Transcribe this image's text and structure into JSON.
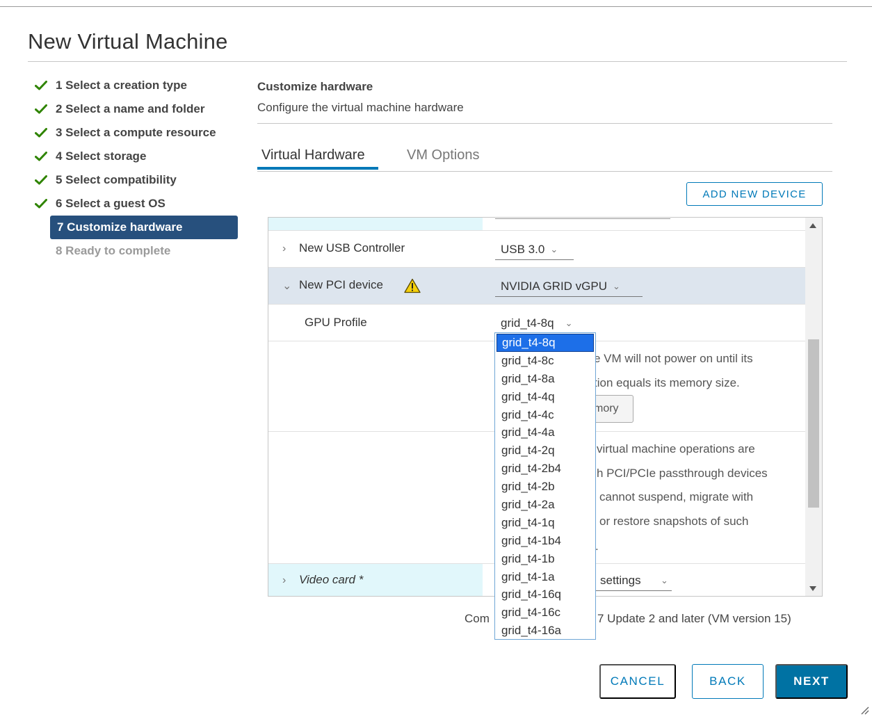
{
  "dialog": {
    "title": "New Virtual Machine"
  },
  "steps": [
    {
      "label": "1 Select a creation type",
      "status": "complete"
    },
    {
      "label": "2 Select a name and folder",
      "status": "complete"
    },
    {
      "label": "3 Select a compute resource",
      "status": "complete"
    },
    {
      "label": "4 Select storage",
      "status": "complete"
    },
    {
      "label": "5 Select compatibility",
      "status": "complete"
    },
    {
      "label": "6 Select a guest OS",
      "status": "complete"
    },
    {
      "label": "7 Customize hardware",
      "status": "active"
    },
    {
      "label": "8 Ready to complete",
      "status": "disabled"
    }
  ],
  "section": {
    "title": "Customize hardware",
    "subtitle": "Configure the virtual machine hardware"
  },
  "tabs": [
    {
      "label": "Virtual Hardware",
      "active": true
    },
    {
      "label": "VM Options",
      "active": false
    }
  ],
  "toolbar": {
    "add_device_label": "ADD NEW DEVICE"
  },
  "hardware": {
    "usb": {
      "label": "New USB Controller",
      "value": "USB 3.0"
    },
    "pci": {
      "label": "New PCI device",
      "value": "NVIDIA GRID vGPU"
    },
    "gpu_profile": {
      "label": "GPU Profile",
      "value": "grid_t4-8q"
    },
    "memory_note": {
      "line1": "e VM will not power on until its",
      "line2": "tion equals its memory size.",
      "button": "mory"
    },
    "passthrough_note": {
      "line1": "virtual machine operations are",
      "line2": "h PCI/PCIe passthrough devices",
      "line3": "cannot suspend, migrate with",
      "line4": "or restore snapshots of such",
      "line5": "."
    },
    "video": {
      "label": "Video card *",
      "value": "settings"
    }
  },
  "gpu_profiles": [
    "grid_t4-8q",
    "grid_t4-8c",
    "grid_t4-8a",
    "grid_t4-4q",
    "grid_t4-4c",
    "grid_t4-4a",
    "grid_t4-2q",
    "grid_t4-2b4",
    "grid_t4-2b",
    "grid_t4-2a",
    "grid_t4-1q",
    "grid_t4-1b4",
    "grid_t4-1b",
    "grid_t4-1a",
    "grid_t4-16q",
    "grid_t4-16c",
    "grid_t4-16a"
  ],
  "compatibility": {
    "prefix": "Com",
    "suffix": "7 Update 2 and later (VM version 15)"
  },
  "footer": {
    "cancel": "CANCEL",
    "back": "BACK",
    "next": "NEXT"
  },
  "colors": {
    "accent": "#0079b8",
    "active_step": "#27507d",
    "check": "#2f8400",
    "highlight": "#1d6fe8"
  }
}
